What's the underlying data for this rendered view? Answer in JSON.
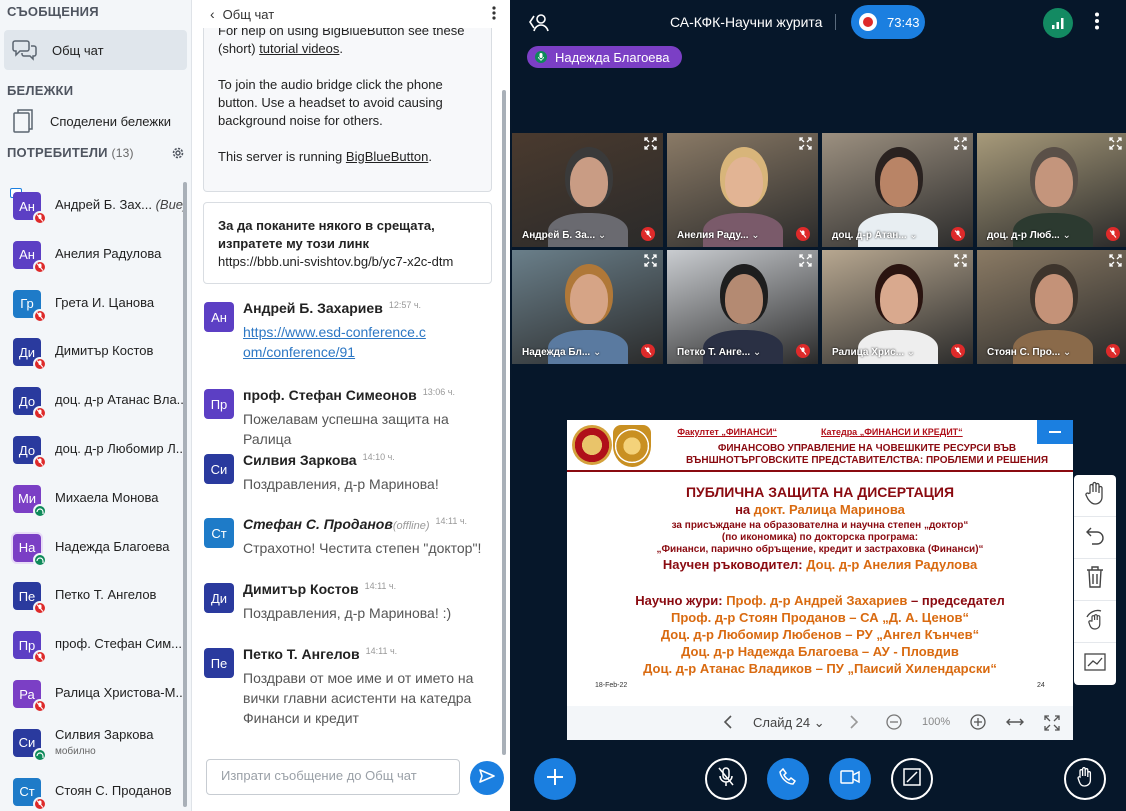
{
  "sidebar": {
    "messages_title": "СЪОБЩЕНИЯ",
    "public_chat": "Общ чат",
    "notes_title": "БЕЛЕЖКИ",
    "shared_notes": "Споделени бележки",
    "users_title": "ПОТРЕБИТЕЛИ",
    "users_count": "(13)",
    "users": [
      {
        "initials": "Ан",
        "name": "Андрей Б. Зах...",
        "you": "(Вие)",
        "color": "#5c3fc4",
        "status": "muted",
        "presenter": true
      },
      {
        "initials": "Ан",
        "name": "Анелия Радулова",
        "color": "#5c3fc4",
        "status": "muted"
      },
      {
        "initials": "Гр",
        "name": "Грета И. Цанова",
        "color": "#1e7bc8",
        "status": "muted"
      },
      {
        "initials": "Ди",
        "name": "Димитър Костов",
        "color": "#2a3a9e",
        "status": "muted"
      },
      {
        "initials": "До",
        "name": "доц. д-р Атанас Вла...",
        "color": "#2a3a9e",
        "status": "muted"
      },
      {
        "initials": "До",
        "name": "доц. д-р Любомир Л...",
        "color": "#2a3a9e",
        "status": "muted"
      },
      {
        "initials": "Ми",
        "name": "Михаела Монова",
        "color": "#7b3fc5",
        "status": "listen"
      },
      {
        "initials": "На",
        "name": "Надежда Благоева",
        "color": "#7b3fc5",
        "status": "listen",
        "talking": true
      },
      {
        "initials": "Пе",
        "name": "Петко Т. Ангелов",
        "color": "#2a3a9e",
        "status": "muted"
      },
      {
        "initials": "Пр",
        "name": "проф. Стефан Сим...",
        "color": "#5c3fc4",
        "status": "muted"
      },
      {
        "initials": "Ра",
        "name": "Ралица Христова-М...",
        "color": "#7b3fc5",
        "status": "muted"
      },
      {
        "initials": "Си",
        "name": "Силвия Заркова",
        "sub": "мобилно",
        "color": "#2a3a9e",
        "status": "listen"
      },
      {
        "initials": "Ст",
        "name": "Стоян С. Проданов",
        "color": "#1e7bc8",
        "status": "muted"
      }
    ]
  },
  "chat": {
    "title": "Общ чат",
    "sys1_a": "For help on using BigBlueButton see these (short)",
    "sys1_link": "tutorial videos",
    "sys1_b": "To join the audio bridge click the phone button. Use a headset to avoid causing background noise for others.",
    "sys1_c": "This server is running",
    "sys1_c_link": "BigBlueButton",
    "invite_title": "За да поканите някого в срещата, изпратете му този линк",
    "invite_link": "https://bbb.uni-svishtov.bg/b/yc7-x2c-dtm",
    "messages": [
      {
        "initials": "Ан",
        "color": "#5c3fc4",
        "name": "Андрей Б. Захариев",
        "time": "12:57 ч.",
        "link": "https://www.esd-conference.com/conference/91"
      },
      {
        "initials": "Пр",
        "color": "#5c3fc4",
        "name": "проф. Стефан Симеонов",
        "time": "13:06 ч.",
        "text": "Пожелавам успешна защита на Ралица"
      },
      {
        "initials": "Си",
        "color": "#2a3a9e",
        "name": "Силвия Заркова",
        "time": "14:10 ч.",
        "text": "Поздравления, д-р Маринова!"
      },
      {
        "initials": "Ст",
        "color": "#1e7bc8",
        "name": "Стефан С. Проданов",
        "offline": "(offline)",
        "time": "14:11 ч.",
        "text": "Страхотно! Честита степен \"доктор\"!"
      },
      {
        "initials": "Ди",
        "color": "#2a3a9e",
        "name": "Димитър Костов",
        "time": "14:11 ч.",
        "text": "Поздравления, д-р Маринова! :)"
      },
      {
        "initials": "Пе",
        "color": "#2a3a9e",
        "name": "Петко Т. Ангелов",
        "time": "14:11 ч.",
        "text": "Поздрави от мое име и от името на вички главни асистенти на катедра Финанси и кредит"
      }
    ],
    "composer_placeholder": "Изпрати съобщение до Общ чат"
  },
  "main": {
    "room_title": "СА-КФК-Научни журита",
    "record_time": "73:43",
    "talking_user": "Надежда Благоева",
    "videos": [
      {
        "name": "Андрей Б. За...",
        "bg": "#4a3a2e"
      },
      {
        "name": "Анелия Раду...",
        "bg": "#8a7a66"
      },
      {
        "name": "доц. д-р Атан...",
        "bg": "#9c9080"
      },
      {
        "name": "доц. д-р Люб...",
        "bg": "#a79a7a"
      },
      {
        "name": "Надежда Бл...",
        "bg": "#6a7f8a"
      },
      {
        "name": "Петко Т. Анге...",
        "bg": "#c9ccd0"
      },
      {
        "name": "Ралица Хрис...",
        "bg": "#b7a790"
      },
      {
        "name": "Стоян С. Про...",
        "bg": "#8a7a64"
      }
    ]
  },
  "slide": {
    "faculty": "Факултет „ФИНАНСИ“",
    "dept": "Катедра „ФИНАНСИ И КРЕДИТ“",
    "heading": "ФИНАНСОВО УПРАВЛЕНИЕ НА ЧОВЕШКИТЕ РЕСУРСИ ВЪВ ВЪНШНОТЪРГОВСКИТЕ ПРЕДСТАВИТЕЛСТВА: ПРОБЛЕМИ И РЕШЕНИЯ",
    "title": "ПУБЛИЧНА ЗАЩИТА НА ДИСЕРТАЦИЯ",
    "on": "на",
    "candidate": "докт. Ралица Маринова",
    "degree": "за присъждане на образователна и научна степен „доктор“",
    "field": "(по икономика) по докторска програма:",
    "program": "„Финанси, парично обръщение, кредит и застраховка (Финанси)“",
    "supervisor_label": "Научен ръководител:",
    "supervisor": "Доц. д-р Анелия Радулова",
    "jury_label": "Научно жури:",
    "jury_1": "Проф. д-р Андрей Захариев",
    "jury_1_role": "– председател",
    "jury_2": "Проф. д-р Стоян Проданов – СА „Д. А. Ценов“",
    "jury_3": "Доц. д-р Любомир Любенов – РУ „Ангел Кънчев“",
    "jury_4": "Доц. д-р Надежда Благоева – АУ - Пловдив",
    "jury_5": "Доц. д-р Атанас Владиков – ПУ „Паисий Хилендарски“",
    "date": "18-Feb-22",
    "page": "24",
    "slide_label": "Слайд 24",
    "zoom": "100%"
  },
  "colors": {
    "accent": "#1b7fe0",
    "muted": "#de2a2a",
    "listen": "#0e8a5a",
    "dark": "#06172a"
  }
}
